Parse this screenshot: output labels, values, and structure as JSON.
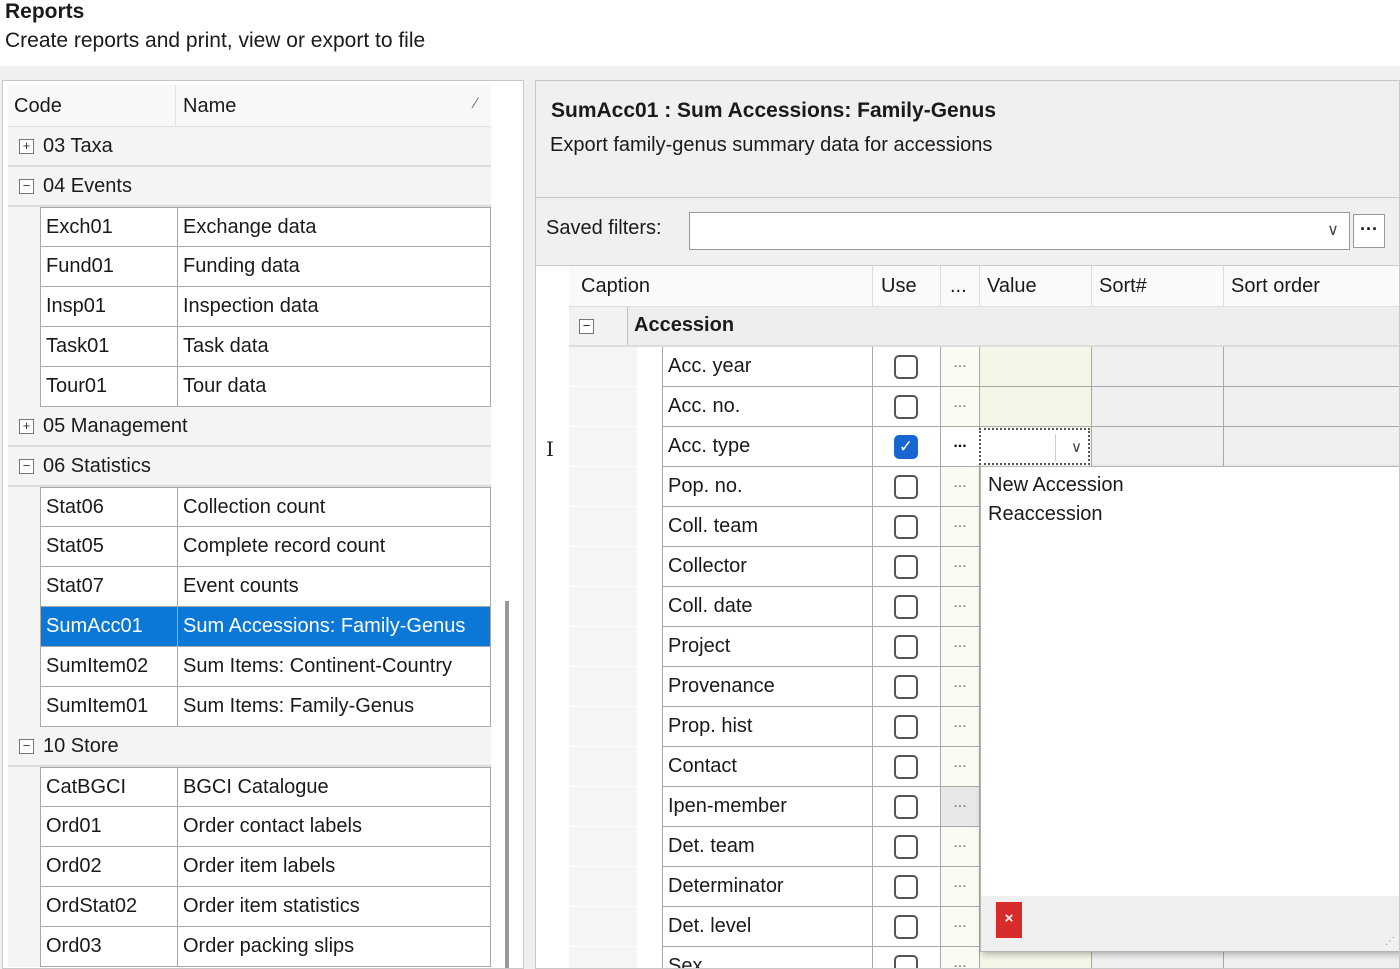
{
  "page": {
    "title": "Reports",
    "subtitle": "Create reports and print, view or export to file"
  },
  "report_list": {
    "columns": {
      "code": "Code",
      "name": "Name"
    },
    "groups": [
      {
        "label": "03 Taxa",
        "expanded": false,
        "items": []
      },
      {
        "label": "04 Events",
        "expanded": true,
        "items": [
          {
            "code": "Exch01",
            "name": "Exchange data"
          },
          {
            "code": "Fund01",
            "name": "Funding data"
          },
          {
            "code": "Insp01",
            "name": "Inspection data"
          },
          {
            "code": "Task01",
            "name": "Task data"
          },
          {
            "code": "Tour01",
            "name": "Tour data"
          }
        ]
      },
      {
        "label": "05 Management",
        "expanded": false,
        "items": []
      },
      {
        "label": "06 Statistics",
        "expanded": true,
        "items": [
          {
            "code": "Stat06",
            "name": "Collection count"
          },
          {
            "code": "Stat05",
            "name": "Complete record count"
          },
          {
            "code": "Stat07",
            "name": "Event counts"
          },
          {
            "code": "SumAcc01",
            "name": "Sum Accessions: Family-Genus",
            "selected": true
          },
          {
            "code": "SumItem02",
            "name": "Sum Items: Continent-Country"
          },
          {
            "code": "SumItem01",
            "name": "Sum Items: Family-Genus"
          }
        ]
      },
      {
        "label": "10 Store",
        "expanded": true,
        "items": [
          {
            "code": "CatBGCI",
            "name": "BGCI Catalogue"
          },
          {
            "code": "Ord01",
            "name": "Order contact labels"
          },
          {
            "code": "Ord02",
            "name": "Order item labels"
          },
          {
            "code": "OrdStat02",
            "name": "Order item statistics"
          },
          {
            "code": "Ord03",
            "name": "Order packing slips"
          }
        ]
      }
    ]
  },
  "report_detail": {
    "title": "SumAcc01 : Sum Accessions: Family-Genus",
    "description": "Export family-genus summary data for accessions",
    "saved_filters_label": "Saved filters:",
    "saved_filters_value": "",
    "more_label": "···"
  },
  "filter_grid": {
    "columns": {
      "caption": "Caption",
      "use": "Use",
      "dots": "...",
      "value": "Value",
      "sort_num": "Sort#",
      "sort_order": "Sort order"
    },
    "group_label": "Accession",
    "rows": [
      {
        "caption": "Acc. year",
        "use": false
      },
      {
        "caption": "Acc. no.",
        "use": false
      },
      {
        "caption": "Acc. type",
        "use": true
      },
      {
        "caption": "Pop. no.",
        "use": false
      },
      {
        "caption": "Coll. team",
        "use": false
      },
      {
        "caption": "Collector",
        "use": false
      },
      {
        "caption": "Coll. date",
        "use": false
      },
      {
        "caption": "Project",
        "use": false
      },
      {
        "caption": "Provenance",
        "use": false
      },
      {
        "caption": "Prop. hist",
        "use": false
      },
      {
        "caption": "Contact",
        "use": false
      },
      {
        "caption": "Ipen-member",
        "use": false
      },
      {
        "caption": "Det. team",
        "use": false
      },
      {
        "caption": "Determinator",
        "use": false
      },
      {
        "caption": "Det. level",
        "use": false
      },
      {
        "caption": "Sex",
        "use": false
      }
    ],
    "cell_dots": "...",
    "value_dropdown": {
      "options": [
        "New Accession",
        "Reaccession"
      ],
      "clear_label": "×"
    }
  },
  "icons": {
    "expand": "plus-box-icon",
    "collapse": "minus-box-icon",
    "chevron": "chevron-down-icon",
    "check": "checkmark-icon",
    "sort": "sort-icon",
    "grip": "resize-grip-icon"
  },
  "colors": {
    "selected_row": "#0b78d7",
    "checkbox_on": "#1766d1",
    "clear_button": "#d82c2c"
  }
}
